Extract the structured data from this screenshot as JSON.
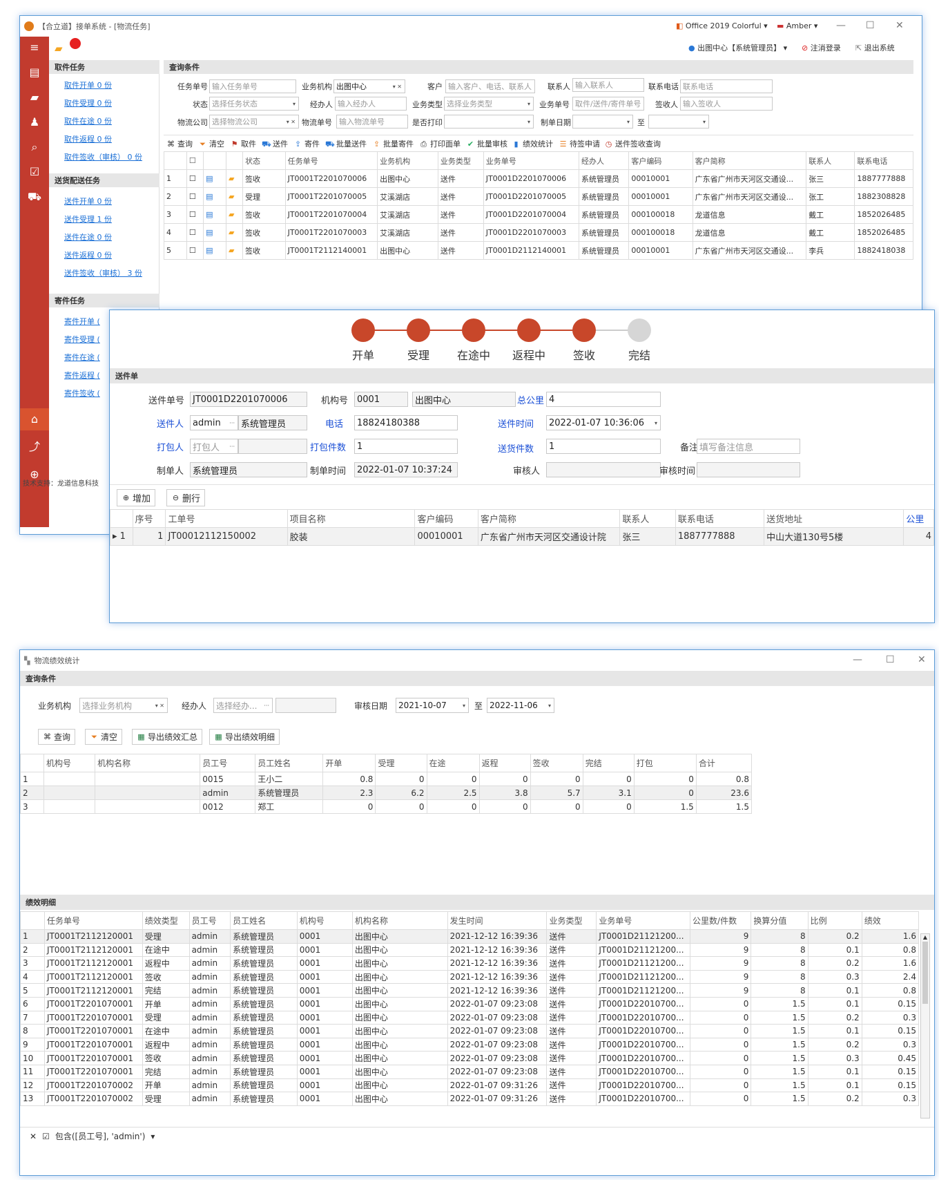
{
  "main_window": {
    "title": "【合立道】接单系统 - [物流任务]",
    "theme": "Office 2019 Colorful",
    "user": "Amber",
    "user_org": "出图中心【系统管理员】",
    "logout": "注消登录",
    "exit": "退出系统",
    "support": "技术支持：龙道信息科技",
    "nav": {
      "pickup_title": "取件任务",
      "pickup": [
        "取件开单 0 份",
        "取件受理 0 份",
        "取件在途 0 份",
        "取件返程 0 份",
        "取件签收（审核） 0 份"
      ],
      "delivery_title": "送货配送任务",
      "delivery": [
        "送件开单 0 份",
        "送件受理 1 份",
        "送件在途 0 份",
        "送件返程 0 份",
        "送件签收（审核） 3 份"
      ],
      "send_title": "寄件任务",
      "send": [
        "寄件开单 (",
        "寄件受理 (",
        "寄件在途 (",
        "寄件返程 (",
        "寄件签收 ("
      ]
    },
    "query": {
      "title": "查询条件",
      "labels": [
        "任务单号",
        "业务机构",
        "客户",
        "联系人",
        "联系电话",
        "状态",
        "经办人",
        "业务类型",
        "业务单号",
        "签收人",
        "物流公司",
        "物流单号",
        "是否打印",
        "制单日期",
        "至"
      ],
      "placeholders": [
        "输入任务单号",
        "出图中心",
        "输入客户、电话、联系人",
        "输入联系人",
        "联系电话",
        "选择任务状态",
        "输入经办人",
        "选择业务类型",
        "取件/送件/寄件单号",
        "输入签收人",
        "选择物流公司",
        "输入物流单号"
      ]
    },
    "toolbar": [
      "查询",
      "清空",
      "取件",
      "送件",
      "寄件",
      "批量送件",
      "批量寄件",
      "打印面单",
      "批量审核",
      "绩效统计",
      "待签申请",
      "送件签收查询"
    ],
    "grid_headers": [
      "状态",
      "任务单号",
      "业务机构",
      "业务类型",
      "业务单号",
      "经办人",
      "客户编码",
      "客户简称",
      "联系人",
      "联系电话"
    ],
    "grid_rows": [
      [
        "1",
        "签收",
        "JT0001T2201070006",
        "出图中心",
        "送件",
        "JT0001D2201070006",
        "系统管理员",
        "00010001",
        "广东省广州市天河区交通设...",
        "张三",
        "1887777888"
      ],
      [
        "2",
        "受理",
        "JT0001T2201070005",
        "艾溪湖店",
        "送件",
        "JT0001D2201070005",
        "系统管理员",
        "00010001",
        "广东省广州市天河区交通设...",
        "张工",
        "1882308828"
      ],
      [
        "3",
        "签收",
        "JT0001T2201070004",
        "艾溪湖店",
        "送件",
        "JT0001D2201070004",
        "系统管理员",
        "000100018",
        "龙道信息",
        "戴工",
        "1852026485"
      ],
      [
        "4",
        "签收",
        "JT0001T2201070003",
        "艾溪湖店",
        "送件",
        "JT0001D2201070003",
        "系统管理员",
        "000100018",
        "龙道信息",
        "戴工",
        "1852026485"
      ],
      [
        "5",
        "签收",
        "JT0001T2112140001",
        "出图中心",
        "送件",
        "JT0001D2112140001",
        "系统管理员",
        "00010001",
        "广东省广州市天河区交通设...",
        "李兵",
        "1882418038"
      ]
    ]
  },
  "detail": {
    "steps": [
      "开单",
      "受理",
      "在途中",
      "返程中",
      "签收",
      "完结"
    ],
    "section": "送件单",
    "labels": {
      "no": "送件单号",
      "org": "机构号",
      "km": "总公里",
      "sender": "送件人",
      "phone": "电话",
      "time": "送件时间",
      "packer": "打包人",
      "pack_cnt": "打包件数",
      "send_cnt": "送货件数",
      "remark": "备注",
      "creator": "制单人",
      "ctime": "制单时间",
      "auditor": "审核人",
      "atime": "审核时间"
    },
    "values": {
      "no": "JT0001D2201070006",
      "org": "0001",
      "org_name": "出图中心",
      "km": "4",
      "sender": "admin",
      "sender_name": "系统管理员",
      "phone": "18824180388",
      "time": "2022-01-07 10:36:06",
      "packer_ph": "打包人",
      "pack_cnt": "1",
      "send_cnt": "1",
      "remark_ph": "填写备注信息",
      "creator": "系统管理员",
      "ctime": "2022-01-07 10:37:24"
    },
    "add": "增加",
    "del": "删行",
    "headers": [
      "序号",
      "工单号",
      "项目名称",
      "客户编码",
      "客户简称",
      "联系人",
      "联系电话",
      "送货地址",
      "公里"
    ],
    "row": [
      "1",
      "JT00012112150002",
      "胶装",
      "00010001",
      "广东省广州市天河区交通设计院",
      "张三",
      "1887777888",
      "中山大道130号5楼",
      "4"
    ]
  },
  "perf": {
    "title": "物流绩效统计",
    "query_title": "查询条件",
    "labels": [
      "业务机构",
      "经办人",
      "审核日期",
      "至"
    ],
    "ph_org": "选择业务机构",
    "ph_agent": "选择经办...",
    "date_from": "2021-10-07",
    "date_to": "2022-11-06",
    "buttons": [
      "查询",
      "清空",
      "导出绩效汇总",
      "导出绩效明细"
    ],
    "sum_headers": [
      "机构号",
      "机构名称",
      "员工号",
      "员工姓名",
      "开单",
      "受理",
      "在途",
      "返程",
      "签收",
      "完结",
      "打包",
      "合计"
    ],
    "sum_rows": [
      [
        "1",
        "",
        "",
        "0015",
        "王小二",
        "0.8",
        "0",
        "0",
        "0",
        "0",
        "0",
        "0",
        "0.8"
      ],
      [
        "2",
        "",
        "",
        "admin",
        "系统管理员",
        "2.3",
        "6.2",
        "2.5",
        "3.8",
        "5.7",
        "3.1",
        "0",
        "23.6"
      ],
      [
        "3",
        "",
        "",
        "0012",
        "郑工",
        "0",
        "0",
        "0",
        "0",
        "0",
        "0",
        "1.5",
        "1.5"
      ]
    ],
    "detail_title": "绩效明细",
    "det_headers": [
      "任务单号",
      "绩效类型",
      "员工号",
      "员工姓名",
      "机构号",
      "机构名称",
      "发生时间",
      "业务类型",
      "业务单号",
      "公里数/件数",
      "换算分值",
      "比例",
      "绩效"
    ],
    "det_rows": [
      [
        "1",
        "JT0001T2112120001",
        "受理",
        "admin",
        "系统管理员",
        "0001",
        "出图中心",
        "2021-12-12 16:39:36",
        "送件",
        "JT0001D21121200...",
        "9",
        "8",
        "0.2",
        "1.6"
      ],
      [
        "2",
        "JT0001T2112120001",
        "在途中",
        "admin",
        "系统管理员",
        "0001",
        "出图中心",
        "2021-12-12 16:39:36",
        "送件",
        "JT0001D21121200...",
        "9",
        "8",
        "0.1",
        "0.8"
      ],
      [
        "3",
        "JT0001T2112120001",
        "返程中",
        "admin",
        "系统管理员",
        "0001",
        "出图中心",
        "2021-12-12 16:39:36",
        "送件",
        "JT0001D21121200...",
        "9",
        "8",
        "0.2",
        "1.6"
      ],
      [
        "4",
        "JT0001T2112120001",
        "签收",
        "admin",
        "系统管理员",
        "0001",
        "出图中心",
        "2021-12-12 16:39:36",
        "送件",
        "JT0001D21121200...",
        "9",
        "8",
        "0.3",
        "2.4"
      ],
      [
        "5",
        "JT0001T2112120001",
        "完结",
        "admin",
        "系统管理员",
        "0001",
        "出图中心",
        "2021-12-12 16:39:36",
        "送件",
        "JT0001D21121200...",
        "9",
        "8",
        "0.1",
        "0.8"
      ],
      [
        "6",
        "JT0001T2201070001",
        "开单",
        "admin",
        "系统管理员",
        "0001",
        "出图中心",
        "2022-01-07 09:23:08",
        "送件",
        "JT0001D22010700...",
        "0",
        "1.5",
        "0.1",
        "0.15"
      ],
      [
        "7",
        "JT0001T2201070001",
        "受理",
        "admin",
        "系统管理员",
        "0001",
        "出图中心",
        "2022-01-07 09:23:08",
        "送件",
        "JT0001D22010700...",
        "0",
        "1.5",
        "0.2",
        "0.3"
      ],
      [
        "8",
        "JT0001T2201070001",
        "在途中",
        "admin",
        "系统管理员",
        "0001",
        "出图中心",
        "2022-01-07 09:23:08",
        "送件",
        "JT0001D22010700...",
        "0",
        "1.5",
        "0.1",
        "0.15"
      ],
      [
        "9",
        "JT0001T2201070001",
        "返程中",
        "admin",
        "系统管理员",
        "0001",
        "出图中心",
        "2022-01-07 09:23:08",
        "送件",
        "JT0001D22010700...",
        "0",
        "1.5",
        "0.2",
        "0.3"
      ],
      [
        "10",
        "JT0001T2201070001",
        "签收",
        "admin",
        "系统管理员",
        "0001",
        "出图中心",
        "2022-01-07 09:23:08",
        "送件",
        "JT0001D22010700...",
        "0",
        "1.5",
        "0.3",
        "0.45"
      ],
      [
        "11",
        "JT0001T2201070001",
        "完结",
        "admin",
        "系统管理员",
        "0001",
        "出图中心",
        "2022-01-07 09:23:08",
        "送件",
        "JT0001D22010700...",
        "0",
        "1.5",
        "0.1",
        "0.15"
      ],
      [
        "12",
        "JT0001T2201070002",
        "开单",
        "admin",
        "系统管理员",
        "0001",
        "出图中心",
        "2022-01-07 09:31:26",
        "送件",
        "JT0001D22010700...",
        "0",
        "1.5",
        "0.1",
        "0.15"
      ],
      [
        "13",
        "JT0001T2201070002",
        "受理",
        "admin",
        "系统管理员",
        "0001",
        "出图中心",
        "2022-01-07 09:31:26",
        "送件",
        "JT0001D22010700...",
        "0",
        "1.5",
        "0.2",
        "0.3"
      ]
    ],
    "filter": "包含([员工号], 'admin')"
  }
}
